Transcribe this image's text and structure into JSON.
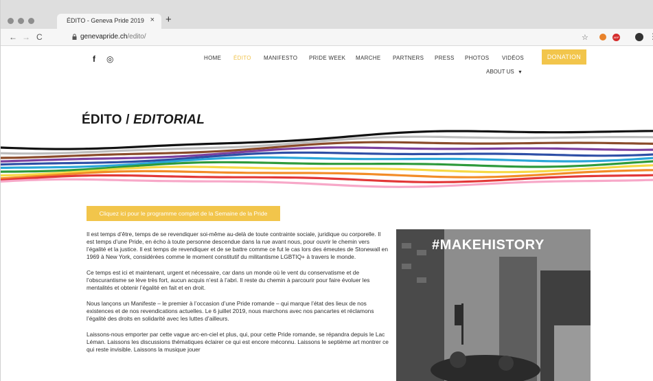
{
  "browser": {
    "tab_title": "ÉDITO - Geneva Pride 2019",
    "tab_close": "×",
    "new_tab": "+",
    "url_host": "genevapride.ch",
    "url_path": "/edito/",
    "back": "←",
    "forward": "→",
    "reload": "C",
    "bookmark": "☆",
    "ext_adblock": "ABP"
  },
  "social": {
    "facebook": "f",
    "instagram": "◎"
  },
  "nav": {
    "items": [
      {
        "label": "HOME"
      },
      {
        "label": "ÉDITO"
      },
      {
        "label": "MANIFESTO"
      },
      {
        "label": "PRIDE WEEK"
      },
      {
        "label": "MARCHE"
      },
      {
        "label": "PARTNERS"
      },
      {
        "label": "PRESS"
      },
      {
        "label": "PHOTOS"
      },
      {
        "label": "VIDÉOS"
      }
    ],
    "donation": "DONATION",
    "about": "ABOUT US"
  },
  "page": {
    "title_main": "ÉDITO / ",
    "title_em": "EDITORIAL",
    "cta": "Cliquez ici pour le programme complet de la Semaine de la Pride",
    "paragraphs": [
      "Il est temps d’être, temps de se revendiquer soi-même au-delà de toute contrainte sociale, juridique ou corporelle. Il est temps d’une Pride, en écho à toute personne descendue dans la rue avant nous, pour ouvrir le chemin vers l’égalité et la justice. Il est temps de revendiquer et de se battre comme ce fut le cas lors des émeutes de Stonewall en 1969 à New York, considérées comme le moment constitutif du militantisme LGBTIQ+ à travers le monde.",
      "Ce temps est ici et maintenant, urgent et nécessaire, car dans un monde où le vent du conservatisme et de l’obscurantisme se lève très fort, aucun acquis n’est à l’abri. Il reste du chemin à parcourir pour faire évoluer les mentalités et obtenir l’égalité en fait et en droit.",
      "Nous lançons un Manifeste – le premier à l’occasion d’une Pride romande – qui marque l’état des lieux de nos existences et de nos revendications actuelles. Le 6 juillet 2019, nous marchons avec nos pancartes et réclamons l’égalité des droits en solidarité avec les luttes d’ailleurs.",
      "Laissons-nous emporter par cette vague arc-en-ciel et plus, qui, pour cette Pride romande, se répandra depuis le Lac Léman. Laissons les discussions thématiques éclairer ce qui est encore méconnu. Laissons le septième art montrer ce qui reste invisible. Laissons la musique jouer"
    ],
    "hashtag": "#MAKEHISTORY"
  },
  "colors": {
    "accent": "#f2c54b",
    "stripes": [
      "#111111",
      "#bdbdbd",
      "#8a4b2a",
      "#7b3f9e",
      "#2e4fa6",
      "#2aa6d8",
      "#2e9a3b",
      "#f6d845",
      "#f28c28",
      "#e23838",
      "#f7a8c8"
    ]
  }
}
